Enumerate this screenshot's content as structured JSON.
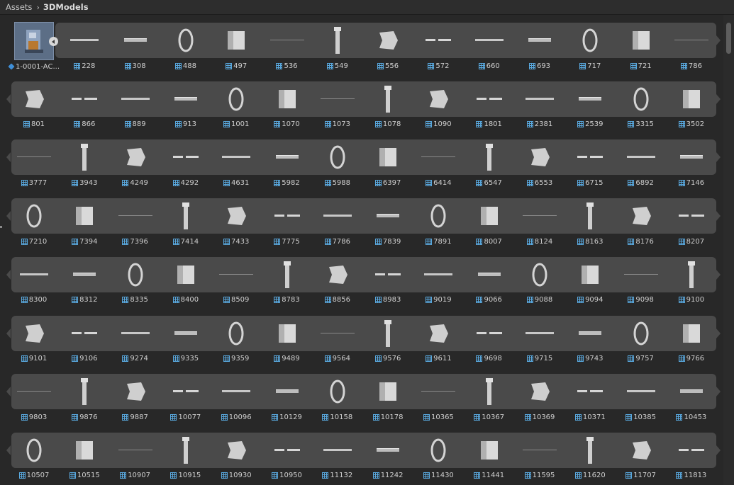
{
  "breadcrumb": {
    "root": "Assets",
    "current": "3DModels"
  },
  "featured": {
    "label": "1-0001-AC...",
    "icon": "prefab-icon"
  },
  "colors": {
    "strip": "#4a4a4a",
    "mesh_icon": "#59a8de",
    "background": "#282828"
  },
  "rows": [
    [
      "228",
      "308",
      "488",
      "497",
      "536",
      "549",
      "556",
      "572",
      "660",
      "693",
      "717",
      "721",
      "786"
    ],
    [
      "801",
      "866",
      "889",
      "913",
      "1001",
      "1070",
      "1073",
      "1078",
      "1090",
      "1801",
      "2381",
      "2539",
      "3315",
      "3502"
    ],
    [
      "3777",
      "3943",
      "4249",
      "4292",
      "4631",
      "5982",
      "5988",
      "6397",
      "6414",
      "6547",
      "6553",
      "6715",
      "6892",
      "7146"
    ],
    [
      "7210",
      "7394",
      "7396",
      "7414",
      "7433",
      "7775",
      "7786",
      "7839",
      "7891",
      "8007",
      "8124",
      "8163",
      "8176",
      "8207"
    ],
    [
      "8300",
      "8312",
      "8335",
      "8400",
      "8509",
      "8783",
      "8856",
      "8983",
      "9019",
      "9066",
      "9088",
      "9094",
      "9098",
      "9100"
    ],
    [
      "9101",
      "9106",
      "9274",
      "9335",
      "9359",
      "9489",
      "9564",
      "9576",
      "9611",
      "9698",
      "9715",
      "9743",
      "9757",
      "9766"
    ],
    [
      "9803",
      "9876",
      "9887",
      "10077",
      "10096",
      "10129",
      "10158",
      "10178",
      "10365",
      "10367",
      "10369",
      "10371",
      "10385",
      "10453"
    ],
    [
      "10507",
      "10515",
      "10907",
      "10915",
      "10930",
      "10950",
      "11132",
      "11242",
      "11430",
      "11441",
      "11595",
      "11620",
      "11707",
      "11813"
    ]
  ]
}
